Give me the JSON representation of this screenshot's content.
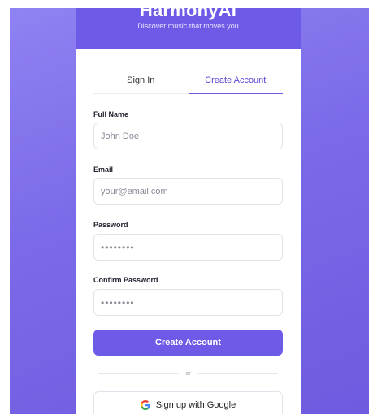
{
  "brand": {
    "title": "HarmonyAI",
    "tagline": "Discover music that moves you"
  },
  "tabs": [
    {
      "label": "Sign In",
      "active": false
    },
    {
      "label": "Create Account",
      "active": true
    }
  ],
  "form": {
    "full_name": {
      "label": "Full Name",
      "placeholder": "John Doe",
      "value": ""
    },
    "email": {
      "label": "Email",
      "placeholder": "your@email.com",
      "value": ""
    },
    "password": {
      "label": "Password",
      "placeholder": "••••••••",
      "value": ""
    },
    "confirm_password": {
      "label": "Confirm Password",
      "placeholder": "••••••••",
      "value": ""
    }
  },
  "submit_label": "Create Account",
  "divider_text": "or",
  "google_button": {
    "label": "Sign up with Google",
    "icon": "google-icon"
  },
  "colors": {
    "accent": "#6d5ae6",
    "background_gradient": [
      "#8f82f2",
      "#6e5bdf"
    ]
  }
}
